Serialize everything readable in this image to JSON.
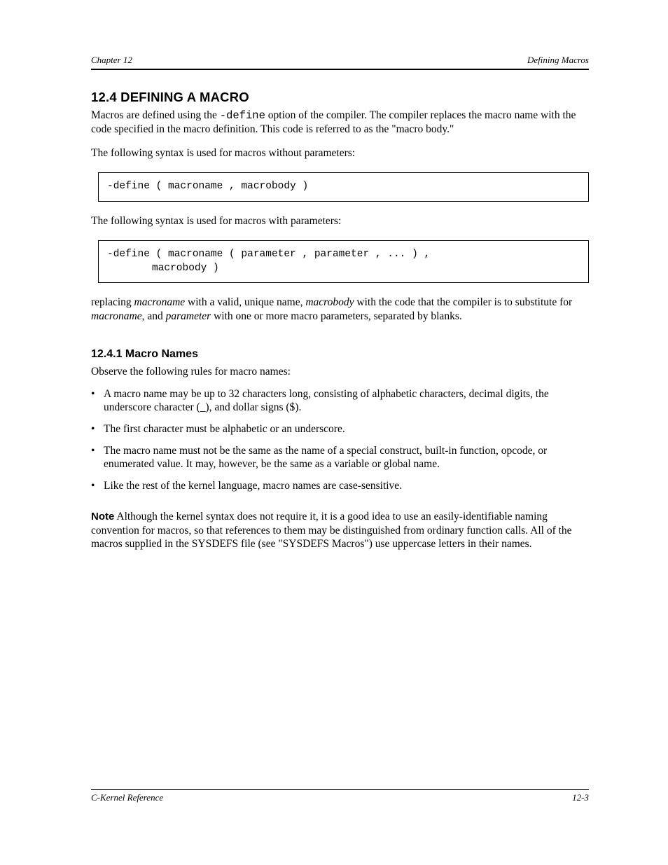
{
  "header": {
    "left": "Chapter 12",
    "right": "Defining Macros"
  },
  "section": {
    "heading": "12.4 DEFINING A MACRO",
    "p1_pre": "Macros are defined using the ",
    "p1_code": "-define",
    "p1_post": " option of the compiler. The compiler replaces the macro name with the code specified in the macro definition. This code is referred to as the \"macro body.\"",
    "p2": "The following syntax is used for macros without parameters:",
    "code1": "-define ( macroname , macrobody )",
    "p3": "The following syntax is used for macros with parameters:",
    "code2_line1": "-define ( macroname ( parameter , parameter , ... ) ,",
    "code2_line2": "macrobody )",
    "p4_a": "replacing ",
    "p4_macroname": "macroname",
    "p4_b": " with a valid, unique name, ",
    "p4_macrobody": "macrobody",
    "p4_c": " with the code that the compiler is to substitute for ",
    "p4_d": ", and ",
    "p4_param": "parameter",
    "p4_e": " with one or more macro parameters, separated by blanks."
  },
  "subsection": {
    "heading": "12.4.1 Macro Names",
    "intro": "Observe the following rules for macro names:",
    "items": [
      "A macro name may be up to 32 characters long, consisting of alphabetic characters, decimal digits, the underscore character (_), and dollar signs ($).",
      "The first character must be alphabetic or an underscore.",
      "The macro name must not be the same as the name of a special construct, built-in function, opcode, or enumerated value. It may, however, be the same as a variable or global name.",
      "Like the rest of the kernel language, macro names are case-sensitive."
    ],
    "note_label": "Note",
    "note_text_a": "Although the kernel syntax does not require it, it is a good idea to use an easily-identifiable naming convention for macros, so that references to them may be distinguished from ordinary function calls. All of the macros supplied in the SYSDEFS file (see \"",
    "note_link": "SYSDEFS Macros",
    "note_text_b": "\") use uppercase letters in their names."
  },
  "footer": {
    "doc": "C-Kernel Reference",
    "page": "12-3"
  }
}
